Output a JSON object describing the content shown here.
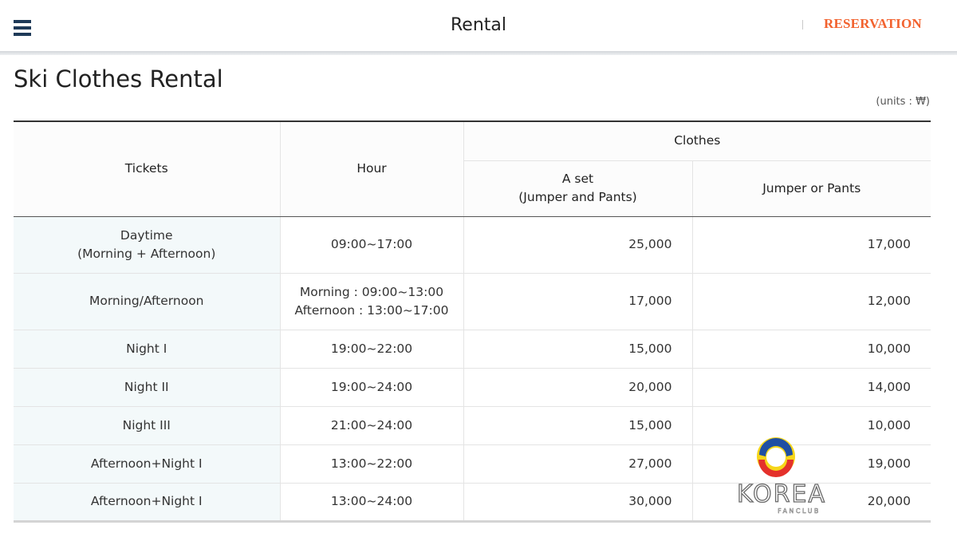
{
  "header": {
    "title": "Rental",
    "reservation_label": "RESERVATION"
  },
  "page": {
    "title": "Ski Clothes Rental",
    "units": "(units : ₩)"
  },
  "table": {
    "headers": {
      "tickets": "Tickets",
      "hour": "Hour",
      "clothes": "Clothes",
      "set_line1": "A set",
      "set_line2": "(Jumper and Pants)",
      "jumper_or_pants": "Jumper or Pants"
    },
    "rows": [
      {
        "ticket_line1": "Daytime",
        "ticket_line2": "(Morning + Afternoon)",
        "hour_line1": "09:00~17:00",
        "hour_line2": "",
        "set": "25,000",
        "single": "17,000"
      },
      {
        "ticket_line1": "Morning/Afternoon",
        "ticket_line2": "",
        "hour_line1": "Morning : 09:00~13:00",
        "hour_line2": "Afternoon : 13:00~17:00",
        "set": "17,000",
        "single": "12,000"
      },
      {
        "ticket_line1": "Night I",
        "ticket_line2": "",
        "hour_line1": "19:00~22:00",
        "hour_line2": "",
        "set": "15,000",
        "single": "10,000"
      },
      {
        "ticket_line1": "Night II",
        "ticket_line2": "",
        "hour_line1": "19:00~24:00",
        "hour_line2": "",
        "set": "20,000",
        "single": "14,000"
      },
      {
        "ticket_line1": "Night III",
        "ticket_line2": "",
        "hour_line1": "21:00~24:00",
        "hour_line2": "",
        "set": "15,000",
        "single": "10,000"
      },
      {
        "ticket_line1": "Afternoon+Night I",
        "ticket_line2": "",
        "hour_line1": "13:00~22:00",
        "hour_line2": "",
        "set": "27,000",
        "single": "19,000"
      },
      {
        "ticket_line1": "Afternoon+Night I",
        "ticket_line2": "",
        "hour_line1": "13:00~24:00",
        "hour_line2": "",
        "set": "30,000",
        "single": "20,000"
      }
    ]
  },
  "watermark": {
    "text": "KOREA",
    "subtext": "FANCLUB"
  },
  "colors": {
    "accent": "#f2622e",
    "menu_icon": "#1e3a58",
    "ticket_cell_bg": "#f3f9fa"
  }
}
